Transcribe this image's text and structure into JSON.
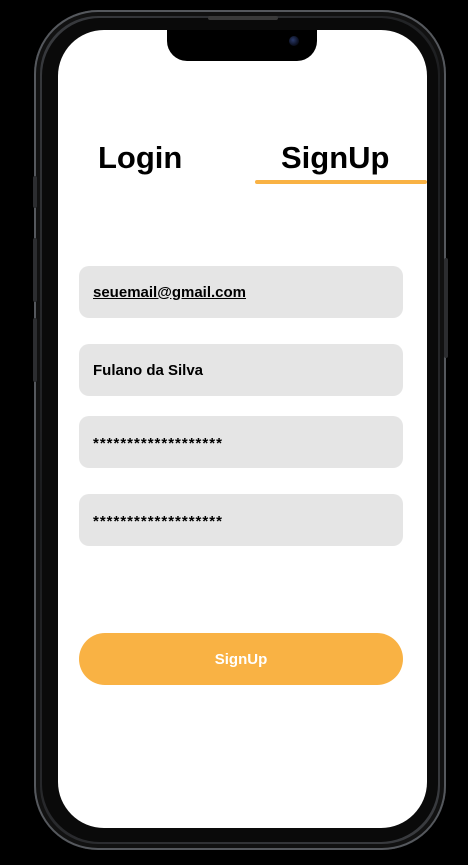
{
  "tabs": {
    "login_label": "Login",
    "signup_label": "SignUp",
    "active": "SignUp"
  },
  "form": {
    "email_value": "seuemail@gmail.com",
    "name_value": "Fulano da Silva",
    "password_value": "*******************",
    "confirm_password_value": "*******************"
  },
  "actions": {
    "signup_button_label": "SignUp"
  },
  "colors": {
    "accent": "#F9B244",
    "field_background": "#E5E5E5",
    "screen_background": "#FFFFFF",
    "device_background": "#000000"
  },
  "icons": {
    "camera": "front-camera-icon"
  }
}
